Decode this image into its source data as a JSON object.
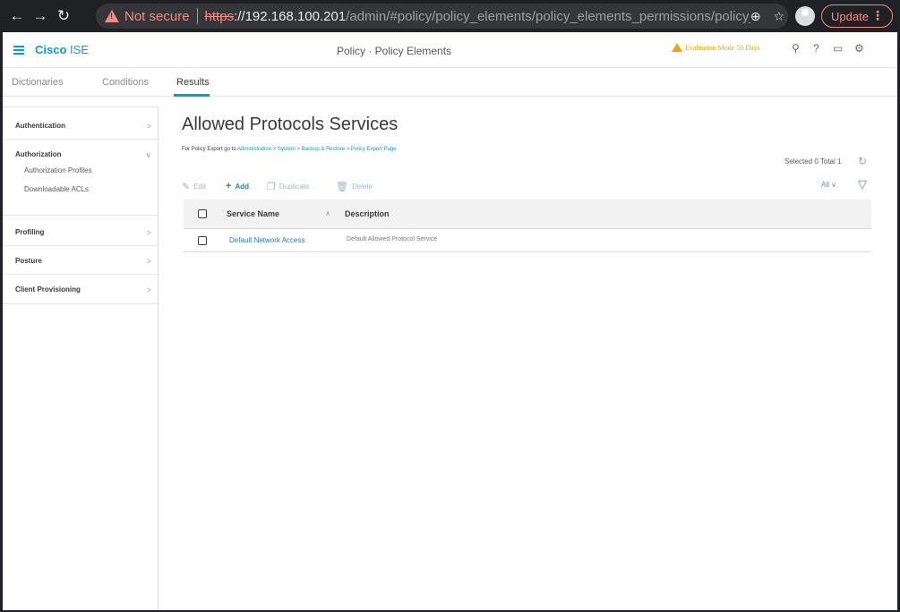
{
  "browser": {
    "security_label": "Not secure",
    "url_scheme": "https",
    "url_host": "://192.168.100.201",
    "url_path": "/admin/#policy/policy_elements/policy_elements_permissions/policy_el...",
    "update_label": "Update"
  },
  "header": {
    "brand_cisco": "Cisco",
    "brand_ise": " ISE",
    "page_title": "Policy · Policy Elements",
    "evaluation_notice": "Evaluation Mode 50 Days"
  },
  "tabs": [
    {
      "label": "Dictionaries"
    },
    {
      "label": "Conditions"
    },
    {
      "label": "Results"
    }
  ],
  "sidebar": {
    "sections": [
      {
        "label": "Authentication"
      },
      {
        "label": "Authorization",
        "children": [
          "Authorization Profiles",
          "Downloadable ACLs"
        ]
      },
      {
        "label": "Profiling"
      },
      {
        "label": "Posture"
      },
      {
        "label": "Client Provisioning"
      }
    ]
  },
  "main": {
    "title": "Allowed Protocols Services",
    "export_prefix": "For Policy Export go to ",
    "export_link": "Administration > System > Backup & Restore > Policy Export Page",
    "selected_total": "Selected 0  Total 1",
    "toolbar": {
      "edit": "Edit",
      "add": "Add",
      "duplicate": "Duplicate",
      "delete": "Delete",
      "filter_all": "All"
    },
    "table": {
      "columns": [
        "Service Name",
        "Description"
      ],
      "rows": [
        {
          "service_name": "Default Network Access",
          "description": "Default Allowed Protocol Service"
        }
      ]
    }
  }
}
